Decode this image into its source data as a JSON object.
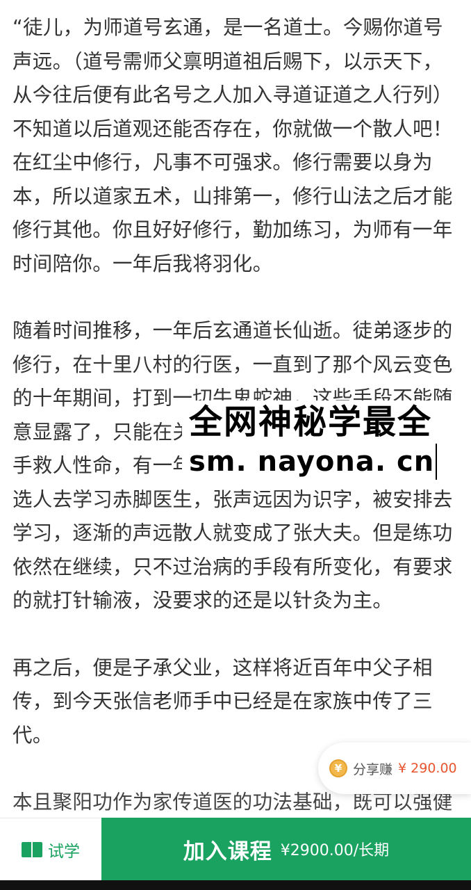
{
  "article": {
    "paragraphs": [
      "“徒儿，为师道号玄通，是一名道士。今赐你道号声远。（道号需师父禀明道祖后赐下，以示天下，从今往后便有此名号之人加入寻道证道之人行列）不知道以后道观还能否存在，你就做一个散人吧！在红尘中修行，凡事不可强求。修行需要以身为本，所以道家五术，山排第一，修行山法之后才能修行其他。你且好好修行，勤加练习，为师有一年时间陪你。一年后我将羽化。",
      "随着时间推移，一年后玄通道长仙逝。徒弟逐步的修行，在十里八村的行医，一直到了那个风云变色的十年期间，打到一切牛鬼蛇神，这些手段不能随意显露了，只能在关键时刻出手救人性命，时刻出手救人性命，有一年生产队响应上级指示，从队里选人去学习赤脚医生，张声远因为识字，被安排去学习，逐渐的声远散人就变成了张大夫。但是练功依然在继续，只不过治病的手段有所变化，有要求的就打针输液，没要求的还是以针灸为主。",
      "再之后，便是子承父业，这样将近百年中父子相传，到今天张信老师手中已经是在家族中传了三代。",
      "本且聚阳功作为家传道医的功法基础，既可以强健自身"
    ]
  },
  "watermark": {
    "line1": "全网神秘学最全",
    "line2": "sm. nayona. cn"
  },
  "share": {
    "icon": "coin-icon",
    "coin_symbol": "¥",
    "label": "分享赚",
    "amount": "¥ 290.00"
  },
  "bottom_bar": {
    "trial_icon": "book-icon",
    "trial_label": "试学",
    "join_label": "加入课程",
    "join_price": "¥2900.00/长期",
    "accent_color": "#1aa260"
  }
}
